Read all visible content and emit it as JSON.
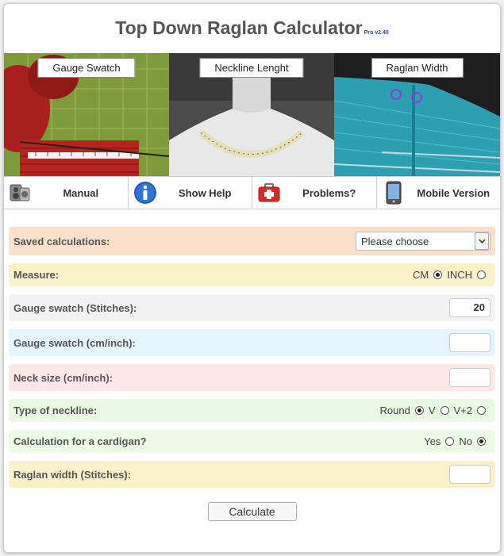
{
  "app": {
    "title": "Top Down Raglan Calculator",
    "version": "Pro v2.40"
  },
  "photos": [
    {
      "label": "Gauge Swatch"
    },
    {
      "label": "Neckline Lenght"
    },
    {
      "label": "Raglan Width"
    }
  ],
  "menu": [
    {
      "label": "Manual",
      "icon": "speaker-icon"
    },
    {
      "label": "Show Help",
      "icon": "info-icon"
    },
    {
      "label": "Problems?",
      "icon": "first-aid-kit-icon"
    },
    {
      "label": "Mobile Version",
      "icon": "mobile-phone-icon"
    }
  ],
  "form": {
    "saved": {
      "label": "Saved calculations:",
      "value": "Please choose"
    },
    "measure": {
      "label": "Measure:",
      "cm": "CM",
      "inch": "INCH",
      "selected": "CM"
    },
    "gauge_stitches": {
      "label": "Gauge swatch (Stitches):",
      "value": "20"
    },
    "gauge_length": {
      "label": "Gauge swatch (cm/inch):",
      "value": ""
    },
    "neck_size": {
      "label": "Neck size (cm/inch):",
      "value": ""
    },
    "neckline": {
      "label": "Type of neckline:",
      "round": "Round",
      "v": "V",
      "v2": "V+2",
      "selected": "Round"
    },
    "cardigan": {
      "label": "Calculation for a cardigan?",
      "yes": "Yes",
      "no": "No",
      "selected": "No"
    },
    "raglan_width": {
      "label": "Raglan width (Stitches):",
      "value": ""
    }
  },
  "calculate_label": "Calculate",
  "colors": {
    "saved_bg": "#fbe0cb",
    "measure_bg": "#fbf1c8",
    "gauge_stitches_bg": "#f2f2f2",
    "gauge_length_bg": "#e3f4fb",
    "neck_bg": "#fde7e7",
    "neckline_bg": "#e9f8e3",
    "cardigan_bg": "#ecfae6",
    "raglan_bg": "#fbf1c8"
  }
}
